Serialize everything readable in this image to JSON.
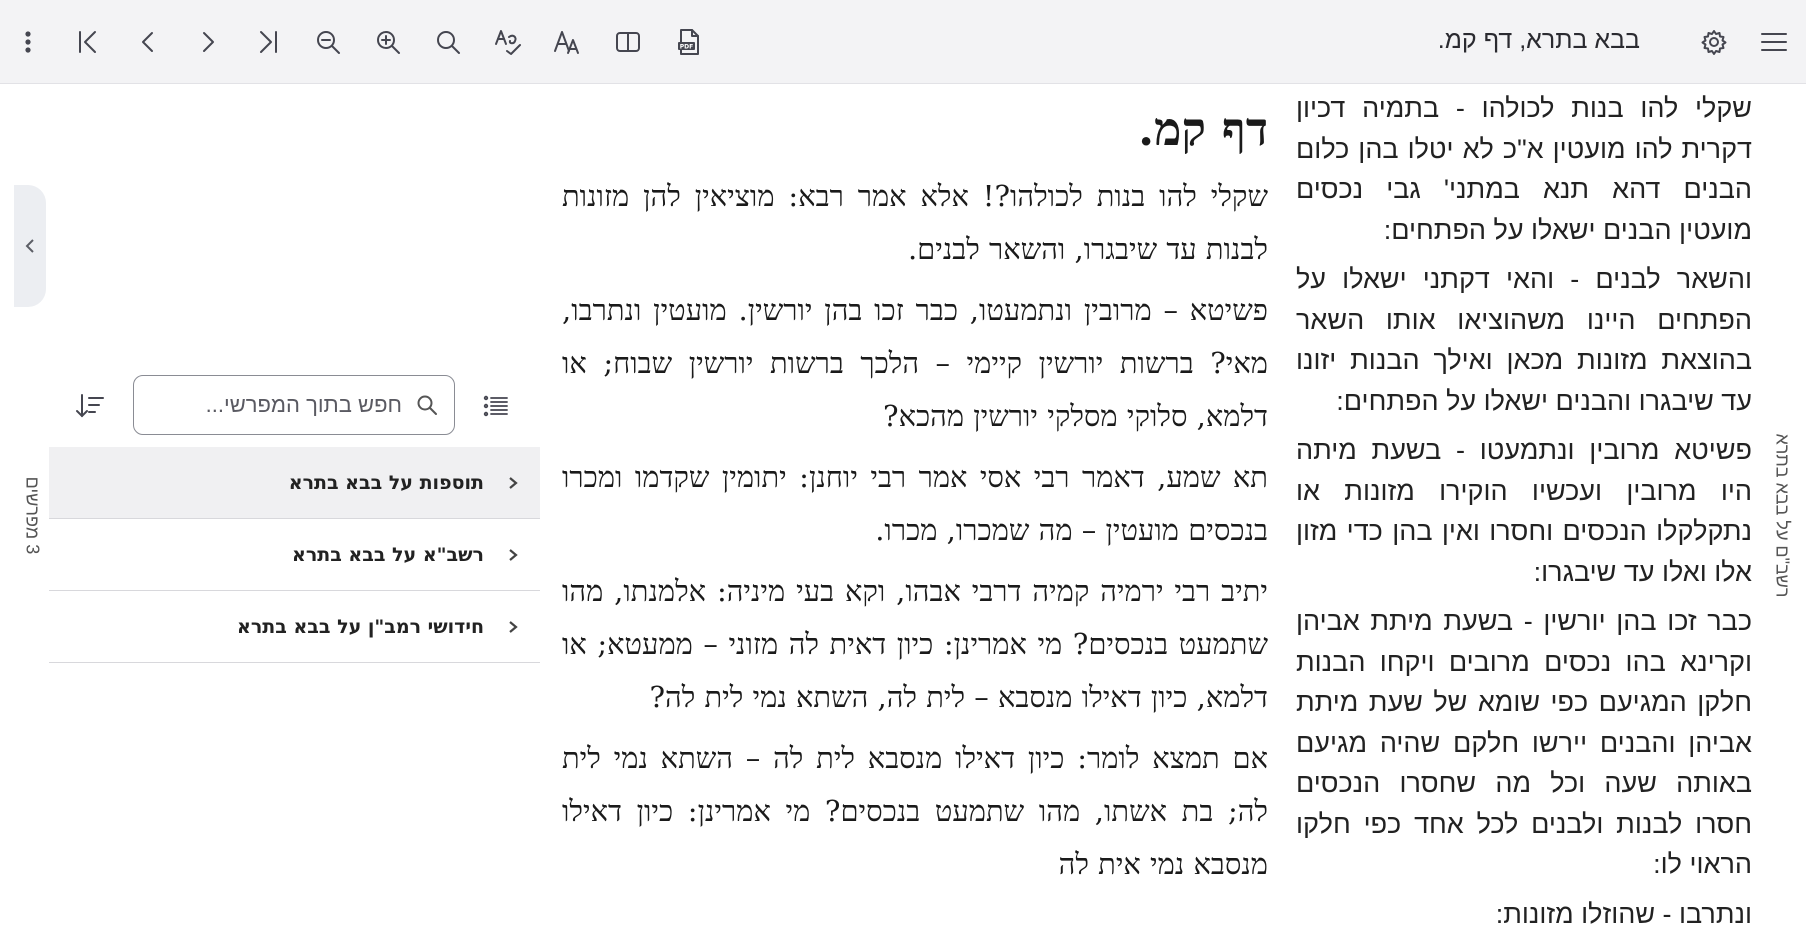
{
  "toolbar": {
    "title": "בבא בתרא, דף קמ.",
    "icons": [
      "menu-icon",
      "settings-icon",
      "pdf-icon",
      "split-view-icon",
      "font-size-icon",
      "spell-check-icon",
      "search-icon",
      "zoom-in-icon",
      "zoom-out-icon",
      "last-page-icon",
      "next-icon",
      "previous-icon",
      "first-page-icon",
      "more-vertical-icon"
    ]
  },
  "main": {
    "title": "דף קמ.",
    "paragraphs": [
      "שקלי להו בנות לכולהו?! אלא אמר רבא: מוציאין להן מזונות לבנות עד שיבגרו, והשאר לבנים.",
      "פשיטא – מרובין ונתמעטו, כבר זכו בהן יורשין. מועטין ונתרבו, מאי? ברשות יורשין קיימי – הלכך ברשות יורשין שבוח; או דלמא, סלוקי מסלקי יורשין מהכא?",
      "תא שמע, דאמר רבי אסי אמר רבי יוחנן: יתומין שקדמו ומכרו בנכסים מועטין – מה שמכרו, מכרו.",
      "יתיב רבי ירמיה קמיה דרבי אבהו, וקא בעי מיניה: אלמנתו, מהו שתמעט בנכסים? מי אמרינן: כיון דאית לה מזוני – ממעטא; או דלמא, כיון דאילו מנסבא – לית לה, השתא נמי לית לה?",
      "אם תמצא לומר: כיון דאילו מנסבא לית לה – השתא נמי לית לה; בת אשתו, מהו שתמעט בנכסים? מי אמרינן: כיון דאילו מנסבא נמי אית לה"
    ]
  },
  "right_commentary": {
    "tab_label": "רשב\"ם על בבא בתרא",
    "paragraphs": [
      "שקלי להו בנות לכולהו - בתמיה דכיון דקרית להו מועטין א\"כ לא יטלו בהן כלום הבנים דהא תנא במתני' גבי נכסים מועטין הבנים ישאלו על הפתחים:",
      "והשאר לבנים - והאי דקתני ישאלו על הפתחים היינו משהוציאו אותו השאר בהוצאת מזונות מכאן ואילך הבנות יזונו עד שיבגרו והבנים ישאלו על הפתחים:",
      "פשיטא מרובין ונתמעטו - בשעת מיתה היו מרובין ועכשיו הוקירו מזונות או נתקלקלו הנכסים וחסרו ואין בהן כדי מזון אלו ואלו עד שיבגרו:",
      "כבר זכו בהן יורשין - בשעת מיתת אביהן וקרינא בהו נכסים מרובים ויקחו הבנות חלקן המגיעם כפי שומא של שעת מיתת אביהן והבנים יירשו חלקם שהיה מגיעם באותה שעה וכל מה שחסרו הנכסים חסרו לבנות ולבנים לכל אחד כפי חלקו הראוי לו:",
      "ונתרבו - שהוזלו מזונות:"
    ]
  },
  "left_panel": {
    "tab_label": "3 מפרשים",
    "search": {
      "placeholder": "חפש בתוך המפרשי...",
      "value": ""
    },
    "commentaries": [
      {
        "label": "תוספות על בבא בתרא",
        "active": true
      },
      {
        "label": "רשב\"א על בבא בתרא",
        "active": false
      },
      {
        "label": "חידושי רמב\"ן על בבא בתרא",
        "active": false
      }
    ]
  }
}
